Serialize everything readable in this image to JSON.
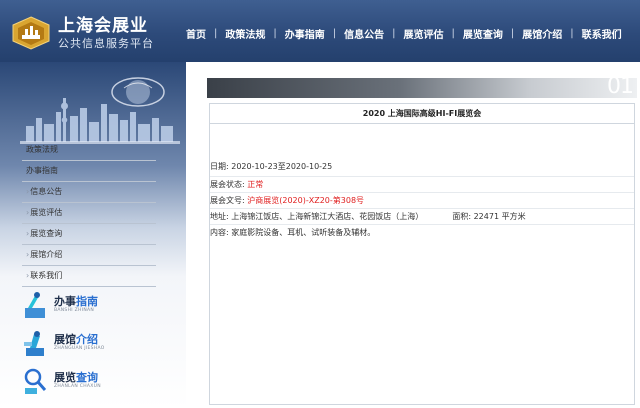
{
  "header": {
    "title": "上海会展业",
    "subtitle": "公共信息服务平台",
    "nav": [
      "首页",
      "政策法规",
      "办事指南",
      "信息公告",
      "展览评估",
      "展览查询",
      "展馆介绍",
      "联系我们"
    ]
  },
  "sidebar": {
    "items": [
      "政策法规",
      "办事指南",
      "信息公告",
      "展览评估",
      "展览查询",
      "展馆介绍",
      "联系我们"
    ],
    "features": [
      {
        "cn_a": "办事",
        "cn_b": "指南",
        "en": "BANSHI ZHINAN"
      },
      {
        "cn_a": "展馆",
        "cn_b": "介绍",
        "en": "ZHANGUAN JIESHAO"
      },
      {
        "cn_a": "展览",
        "cn_b": "查询",
        "en": "ZHANLAN CHAXUN"
      }
    ]
  },
  "banner": {
    "number": "01"
  },
  "detail": {
    "title": "2020 上海国际高级HI-FI展览会",
    "date_label": "日期:",
    "date_value": "2020-10-23至2020-10-25",
    "status_label": "展会状态:",
    "status_value": "正常",
    "doc_label": "展会文号:",
    "doc_value": "沪商展览(2020)-XZ20-第308号",
    "address_label": "地址:",
    "address_value": "上海锦江饭店、上海新锦江大酒店、花园饭店（上海）",
    "area_label": "面积:",
    "area_value": "22471 平方米",
    "content_label": "内容:",
    "content_value": "家庭影院设备、耳机、试听装备及辅材。"
  },
  "colors": {
    "header_bg": "#2d4a7a",
    "accent_red": "#e02020",
    "accent_blue": "#2a6fd0"
  }
}
